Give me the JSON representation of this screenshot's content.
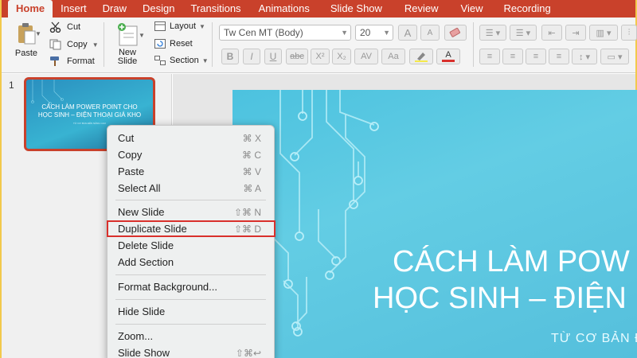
{
  "tabs": [
    "Home",
    "Insert",
    "Draw",
    "Design",
    "Transitions",
    "Animations",
    "Slide Show",
    "Review",
    "View",
    "Recording"
  ],
  "clipboard": {
    "paste": "Paste",
    "cut": "Cut",
    "copy": "Copy",
    "format": "Format"
  },
  "slides_group": {
    "new_slide_line1": "New",
    "new_slide_line2": "Slide",
    "layout": "Layout",
    "reset": "Reset",
    "section": "Section"
  },
  "font": {
    "name": "Tw Cen MT (Body)",
    "size": "20"
  },
  "format_buttons": {
    "bold": "B",
    "italic": "I",
    "underline": "U",
    "strike": "abc",
    "superscript": "X²",
    "subscript": "X₂",
    "spacing": "AV",
    "case": "Aa",
    "grow": "A",
    "shrink": "A",
    "color": "A"
  },
  "thumbnail": {
    "number": "1",
    "title_line1": "CÁCH LÀM POWER POINT CHO",
    "title_line2": "HỌC SINH – ĐIỆN THOẠI GIÁ KHO",
    "subtitle": "TỪ CƠ BẢN ĐẾN NÂNG CAO"
  },
  "slide": {
    "title_line1": "CÁCH LÀM POW",
    "title_line2": "HỌC SINH – ĐIỆN",
    "subtitle": "TỪ CƠ BẢN Đ"
  },
  "context_menu": [
    {
      "label": "Cut",
      "shortcut": "⌘ X"
    },
    {
      "label": "Copy",
      "shortcut": "⌘ C"
    },
    {
      "label": "Paste",
      "shortcut": "⌘ V"
    },
    {
      "label": "Select All",
      "shortcut": "⌘ A"
    },
    {
      "label": "New Slide",
      "shortcut": "⇧⌘ N"
    },
    {
      "label": "Duplicate Slide",
      "shortcut": "⇧⌘ D"
    },
    {
      "label": "Delete Slide",
      "shortcut": ""
    },
    {
      "label": "Add Section",
      "shortcut": ""
    },
    {
      "label": "Format Background...",
      "shortcut": ""
    },
    {
      "label": "Hide Slide",
      "shortcut": ""
    },
    {
      "label": "Zoom...",
      "shortcut": ""
    },
    {
      "label": "Slide Show",
      "shortcut": "⇧⌘↩"
    }
  ],
  "colors": {
    "accent": "#c9412b",
    "highlight_box": "#d9302c",
    "slide_bg": "#55c4df"
  },
  "icons": [
    "paste-icon",
    "cut-icon",
    "copy-icon",
    "format-painter-icon",
    "new-slide-icon",
    "layout-icon",
    "reset-icon",
    "section-icon",
    "bullets-icon",
    "numbering-icon",
    "outdent-icon",
    "indent-icon",
    "columns-icon",
    "align-left-icon",
    "align-center-icon",
    "align-right-icon",
    "justify-icon",
    "text-direction-icon",
    "align-text-icon",
    "highlight-icon",
    "font-color-icon",
    "clear-format-icon"
  ]
}
